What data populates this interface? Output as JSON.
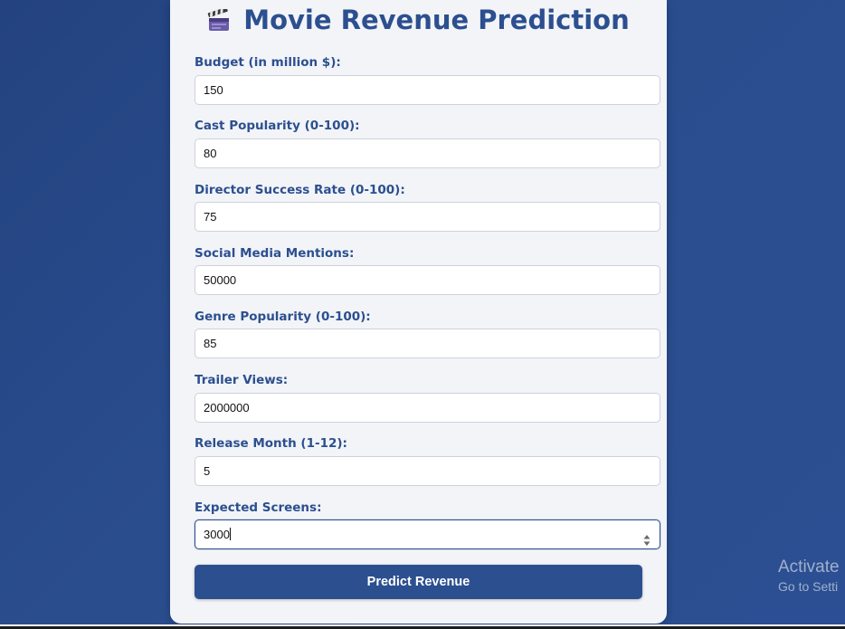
{
  "app": {
    "title": "Movie Revenue Prediction",
    "title_icon": "clapperboard-icon"
  },
  "form": {
    "fields": [
      {
        "label": "Budget (in million $):",
        "value": "150"
      },
      {
        "label": "Cast Popularity (0-100):",
        "value": "80"
      },
      {
        "label": "Director Success Rate (0-100):",
        "value": "75"
      },
      {
        "label": "Social Media Mentions:",
        "value": "50000"
      },
      {
        "label": "Genre Popularity (0-100):",
        "value": "85"
      },
      {
        "label": "Trailer Views:",
        "value": "2000000"
      },
      {
        "label": "Release Month (1-12):",
        "value": "5"
      },
      {
        "label": "Expected Screens:",
        "value": "3000"
      }
    ],
    "submit_label": "Predict Revenue"
  },
  "watermark": {
    "line1": "Activate",
    "line2": "Go to Setti"
  },
  "colors": {
    "accent": "#2c4f8f",
    "background": "#2a4a88",
    "card": "#f2f4f8"
  }
}
